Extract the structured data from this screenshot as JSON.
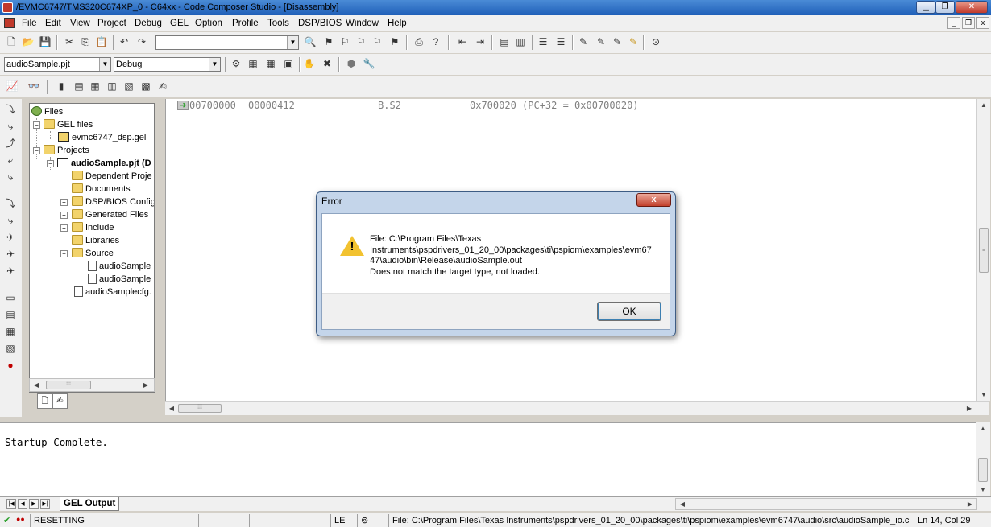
{
  "window": {
    "title": "/EVMC6747/TMS320C674XP_0 - C64xx - Code Composer Studio - [Disassembly]",
    "minimize": "▁",
    "maximize": "❐",
    "close": "✕"
  },
  "menu": {
    "items": [
      "File",
      "Edit",
      "View",
      "Project",
      "Debug",
      "GEL",
      "Option",
      "Profile",
      "Tools",
      "DSP/BIOS",
      "Window",
      "Help"
    ],
    "mdi_minimize": "_",
    "mdi_restore": "❐",
    "mdi_close": "x"
  },
  "toolbar": {
    "search_value": "",
    "project_combo": "audioSample.pjt",
    "config_combo": "Debug"
  },
  "tree": {
    "root": "Files",
    "gel_files": "GEL files",
    "gel_file": "evmc6747_dsp.gel",
    "projects": "Projects",
    "project": "audioSample.pjt (D",
    "dependent": "Dependent Proje",
    "documents": "Documents",
    "dspbios": "DSP/BIOS Config",
    "generated": "Generated Files",
    "include": "Include",
    "libraries": "Libraries",
    "source": "Source",
    "source_file_1": "audioSample",
    "source_file_2": "audioSample",
    "cfg_file": "audioSamplecfg."
  },
  "disassembly": {
    "address": "00700000",
    "opcode": "00000412",
    "instruction": "B.S2",
    "operand": "0x700020 (PC+32 = 0x00700020)"
  },
  "output": {
    "text": "Startup Complete.",
    "tab": "GEL Output"
  },
  "status": {
    "state": "RESETTING",
    "mode": "LE",
    "file": "File: C:\\Program Files\\Texas Instruments\\pspdrivers_01_20_00\\packages\\ti\\pspiom\\examples\\evm6747\\audio\\src\\audioSample_io.c",
    "position": "Ln 14, Col 29"
  },
  "dialog": {
    "title": "Error",
    "close": "x",
    "lines": [
      "File: C:\\Program Files\\Texas",
      "Instruments\\pspdrivers_01_20_00\\packages\\ti\\pspiom\\examples\\evm67",
      "47\\audio\\bin\\Release\\audioSample.out",
      "Does not match the target type, not loaded."
    ],
    "ok": "OK"
  },
  "colors": {
    "titlebar": "#1f5fb8",
    "dialog_frame": "#c4d5ea",
    "warning": "#f2c230",
    "pc_arrow": "#2ca02c"
  }
}
